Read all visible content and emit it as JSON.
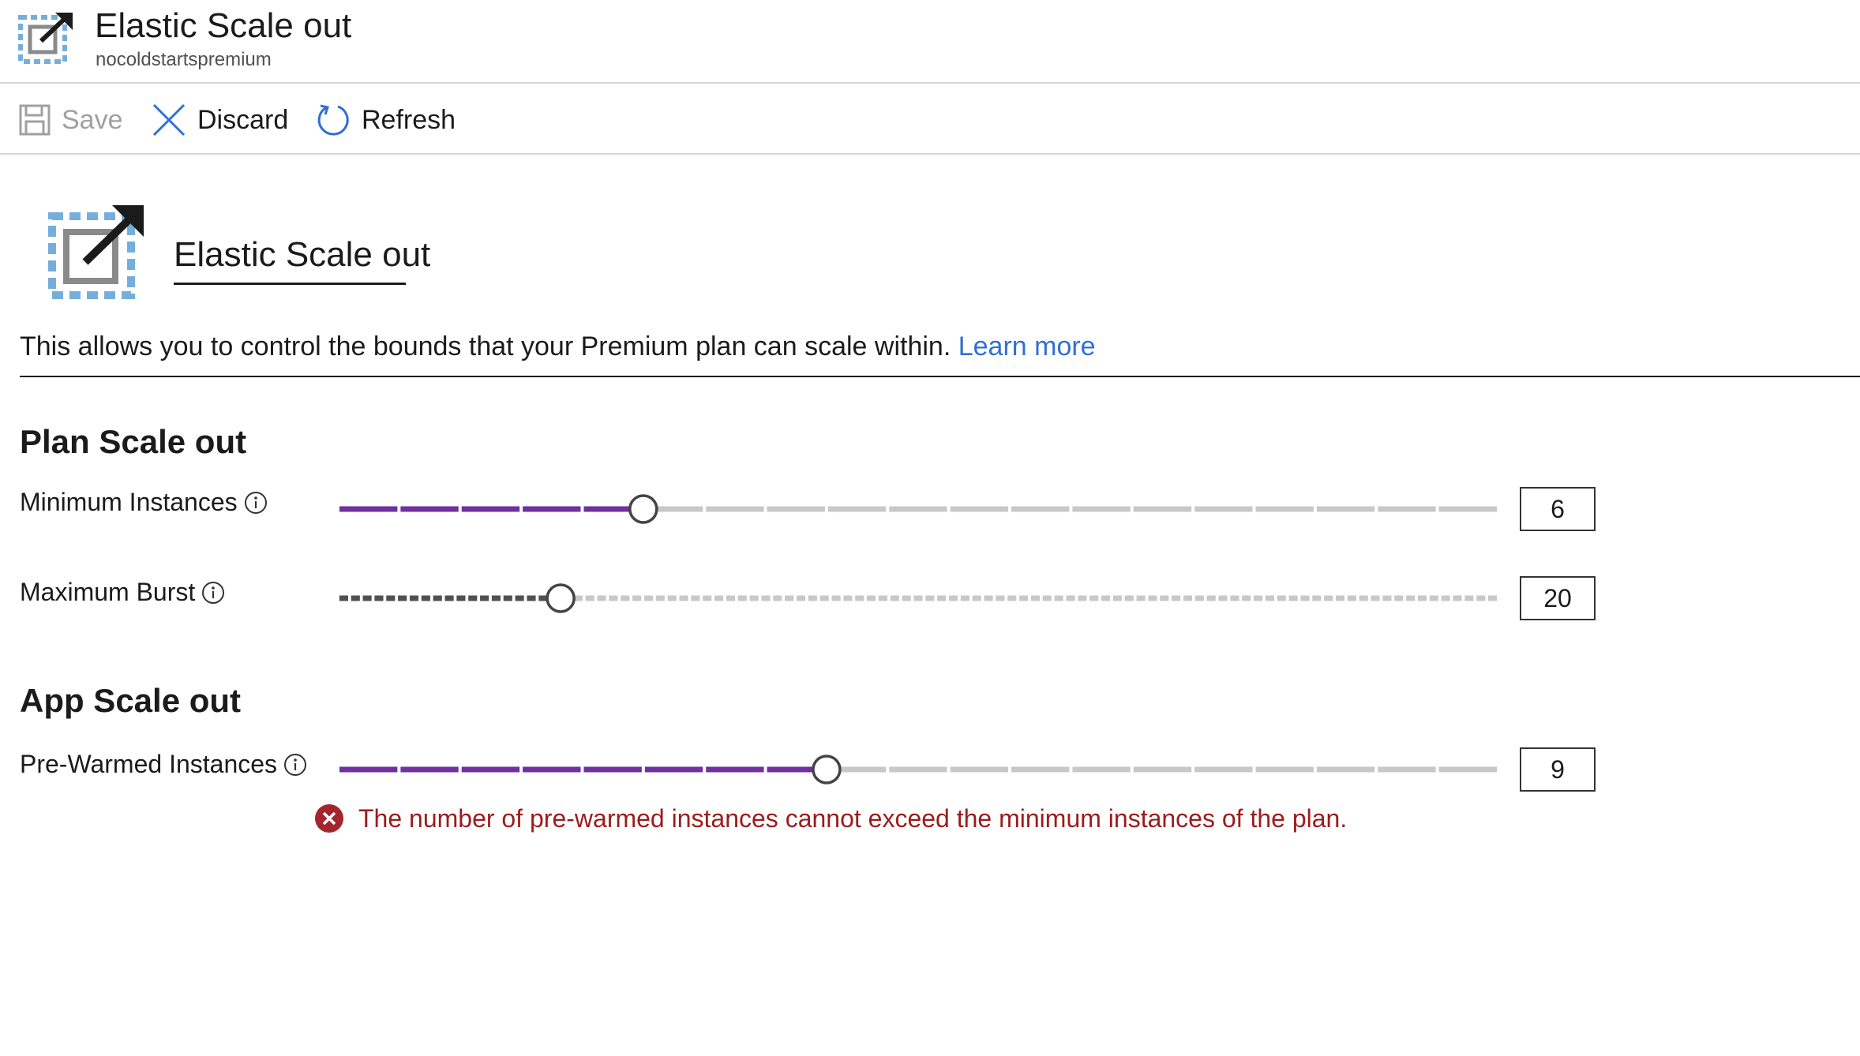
{
  "header": {
    "title": "Elastic Scale out",
    "subtitle": "nocoldstartspremium"
  },
  "toolbar": {
    "save": "Save",
    "discard": "Discard",
    "refresh": "Refresh"
  },
  "hero": {
    "title": "Elastic Scale out"
  },
  "description": {
    "text": "This allows you to control the bounds that your Premium plan can scale within.",
    "link": "Learn more"
  },
  "plan": {
    "title": "Plan Scale out",
    "min_instances": {
      "label": "Minimum Instances",
      "value": "6",
      "max": 20
    },
    "max_burst": {
      "label": "Maximum Burst",
      "value": "20",
      "max": 100
    }
  },
  "app": {
    "title": "App Scale out",
    "prewarmed": {
      "label": "Pre-Warmed Instances",
      "value": "9",
      "max": 20
    }
  },
  "error": {
    "text": "The number of pre-warmed instances cannot exceed the minimum instances of the plan."
  },
  "colors": {
    "accent": "#7030a0",
    "link": "#2f6fd6",
    "error": "#9b1c1c",
    "icon_blue": "#76aedb"
  }
}
